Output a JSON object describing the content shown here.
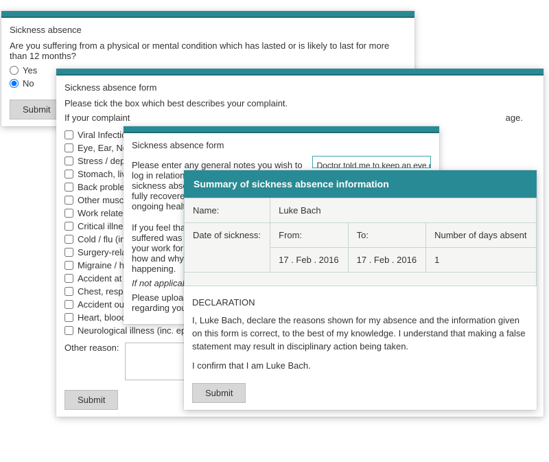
{
  "panel1": {
    "title": "Sickness absence",
    "question": "Are you suffering from a physical or mental condition which has lasted or is likely to last for more than 12 months?",
    "yes": "Yes",
    "no": "No",
    "submit": "Submit"
  },
  "panel2": {
    "title": "Sickness absence form",
    "instruction": "Please tick the box which best describes your complaint.",
    "ifcomplaint_prefix": "If your complaint",
    "ifcomplaint_suffix": "age.",
    "checks": [
      "Viral Infection",
      "Eye, Ear, Nos",
      "Stress / dep",
      "Stomach, liv",
      "Back problem",
      "Other muscu",
      "Work related",
      "Critical illnes",
      "Cold / flu (in",
      "Surgery-rela",
      "Migraine / he",
      "Accident at w",
      "Chest, respir",
      "Accident outside work",
      "Heart, blood pressure, circulation",
      "Neurological illness (inc. epilep"
    ],
    "other_label": "Other reason:",
    "submit": "Submit"
  },
  "panel3": {
    "title": "Sickness absence form",
    "p1": "Please enter any general notes you wish to log in relation t\nsickness absence f\nfully recovered or\nongoing health pr",
    "p2": "If you feel that the\nsuffered was cause\nyour work for us, p\nhow and why you\nhappening.",
    "p2_italic": "If not applicable, pl",
    "p3": "Please upload any\nregarding your sic",
    "notes_value": "Doctor told me to keep an eye on it but I'm"
  },
  "panel4": {
    "header": "Summary of sickness absence information",
    "name_label": "Name:",
    "name_value": "Luke Bach",
    "date_label": "Date of sickness:",
    "from_label": "From:",
    "to_label": "To:",
    "days_label": "Number of days absent",
    "from_value": "17 . Feb . 2016",
    "to_value": "17 . Feb . 2016",
    "days_value": "1",
    "decl_title": "DECLARATION",
    "decl_body": "I, Luke Bach, declare the reasons shown for my absence and the information given on this form is correct, to the best of my knowledge. I understand that making a false statement may result in disciplinary action being taken.",
    "decl_confirm": "I confirm that I am Luke Bach.",
    "submit": "Submit"
  }
}
